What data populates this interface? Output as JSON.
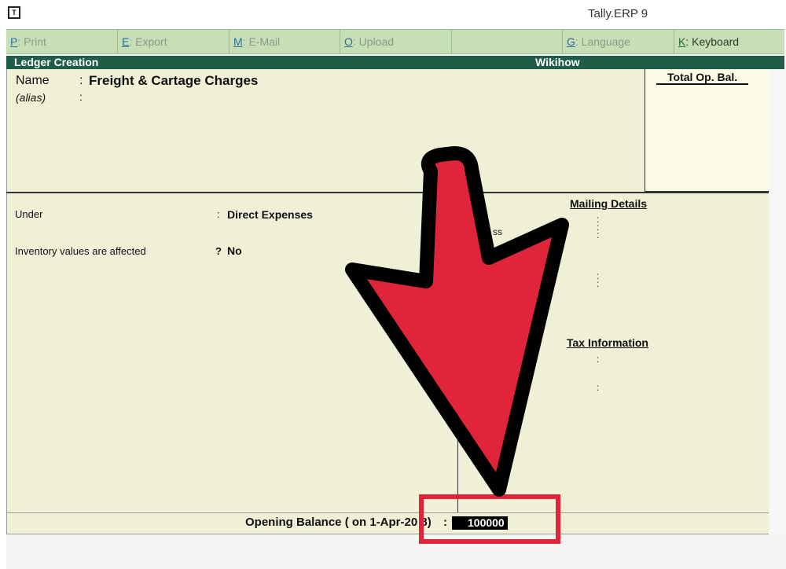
{
  "window": {
    "title": "Tally.ERP 9",
    "icon": "tally-logo-icon"
  },
  "button_bar": [
    {
      "key": "P",
      "label": ": Print",
      "active": false
    },
    {
      "key": "E",
      "label": ": Export",
      "active": false
    },
    {
      "key": "M",
      "label": ": E-Mail",
      "active": false
    },
    {
      "key": "O",
      "label": ": Upload",
      "active": false
    },
    {
      "key": "",
      "label": "",
      "active": false
    },
    {
      "key": "G",
      "label": ": Language",
      "active": false
    },
    {
      "key": "K",
      "label": ": Keyboard",
      "active": true
    }
  ],
  "header": {
    "screen_title": "Ledger Creation",
    "company": "Wikihow"
  },
  "ledger": {
    "name_label": "Name",
    "name_value": "Freight & Cartage Charges",
    "alias_label": "(alias)",
    "colon": ":",
    "total_op_bal_title": "Total Op. Bal."
  },
  "fields": {
    "under_label": "Under",
    "under_sep": ":",
    "under_value": "Direct Expenses",
    "inventory_label": "Inventory values are affected",
    "inventory_sep": "?",
    "inventory_value": "No",
    "partial_text": "ss"
  },
  "sections": {
    "mailing_details": "Mailing Details",
    "tax_information": "Tax Information"
  },
  "opening_balance": {
    "label": "Opening Balance  ( on 1-Apr-20 8)",
    "colon": ":",
    "value": "100000"
  },
  "colors": {
    "header_bg": "#1f5d4a",
    "button_bar_bg": "#c6dfb6",
    "panel_bg": "#f0f0d6",
    "annotation_red": "#e0253b"
  }
}
